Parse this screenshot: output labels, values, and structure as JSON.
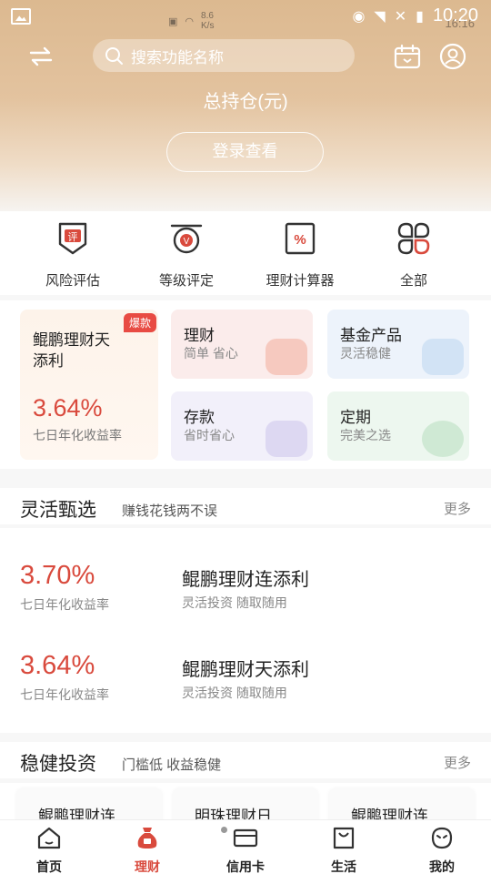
{
  "status_bar": {
    "net_speed_value": "8.6",
    "net_speed_unit": "K/s",
    "time_behind": "16:16",
    "time": "10:20"
  },
  "search": {
    "placeholder": "搜索功能名称"
  },
  "holdings": {
    "title": "总持仓(元)",
    "login_label": "登录查看"
  },
  "quick_actions": [
    {
      "label": "风险评估",
      "icon": "risk-assessment-icon",
      "glyph": "评"
    },
    {
      "label": "等级评定",
      "icon": "level-rating-icon",
      "glyph": "V"
    },
    {
      "label": "理财计算器",
      "icon": "calculator-icon",
      "glyph": "%"
    },
    {
      "label": "全部",
      "icon": "all-apps-icon"
    }
  ],
  "featured": {
    "title": "鲲鹏理财天添利",
    "badge": "爆款",
    "rate": "3.64%",
    "rate_label": "七日年化收益率"
  },
  "category_cards": [
    {
      "title": "理财",
      "subtitle": "简单 省心",
      "color": "#fbe9e7"
    },
    {
      "title": "基金产品",
      "subtitle": "灵活稳健",
      "color": "#eaf2fb"
    },
    {
      "title": "存款",
      "subtitle": "省时省心",
      "color": "#f1effa"
    },
    {
      "title": "定期",
      "subtitle": "完美之选",
      "color": "#ecf7ee"
    }
  ],
  "flexible": {
    "title": "灵活甄选",
    "subtitle": "赚钱花钱两不误",
    "more": "更多",
    "products": [
      {
        "rate": "3.70%",
        "rate_label": "七日年化收益率",
        "name": "鲲鹏理财连添利",
        "tags": "灵活投资  随取随用"
      },
      {
        "rate": "3.64%",
        "rate_label": "七日年化收益率",
        "name": "鲲鹏理财天添利",
        "tags": "灵活投资  随取随用"
      }
    ]
  },
  "robust": {
    "title": "稳健投资",
    "subtitle": "门槛低 收益稳健",
    "more": "更多",
    "cards": [
      "鲲鹏理财连",
      "明珠理财日",
      "鲲鹏理财连"
    ]
  },
  "tabs": [
    {
      "label": "首页",
      "icon": "home-icon",
      "active": false
    },
    {
      "label": "理财",
      "icon": "wealth-bag-icon",
      "active": true
    },
    {
      "label": "信用卡",
      "icon": "credit-card-icon",
      "active": false
    },
    {
      "label": "生活",
      "icon": "shopping-bag-icon",
      "active": false
    },
    {
      "label": "我的",
      "icon": "profile-icon",
      "active": false
    }
  ],
  "colors": {
    "accent": "#d94a3d",
    "header": "#dcb990"
  }
}
